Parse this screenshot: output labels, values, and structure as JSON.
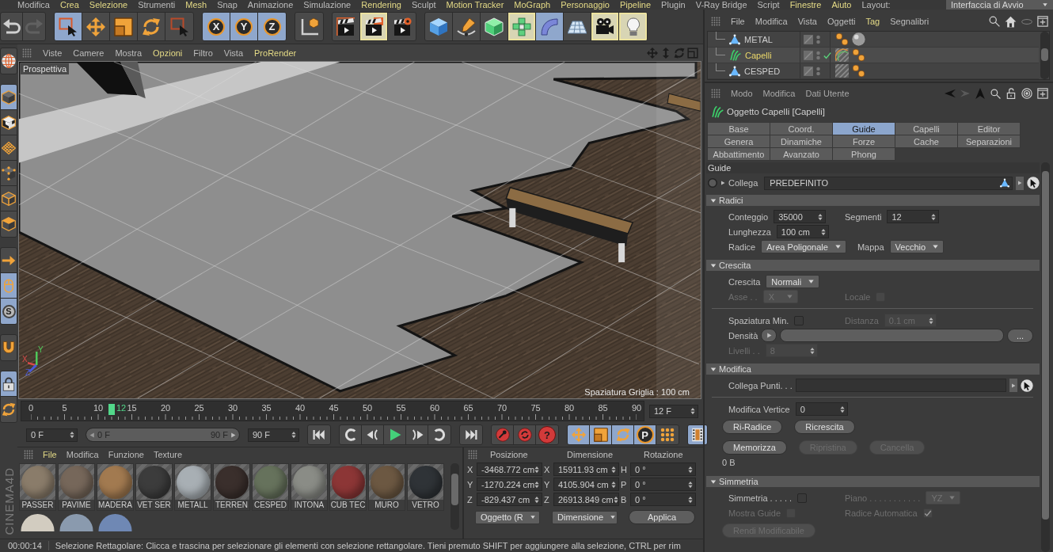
{
  "menu_bar": {
    "items": [
      {
        "label": "Modifica",
        "highlighted": false
      },
      {
        "label": "Crea",
        "highlighted": true
      },
      {
        "label": "Selezione",
        "highlighted": true
      },
      {
        "label": "Strumenti",
        "highlighted": false
      },
      {
        "label": "Mesh",
        "highlighted": true
      },
      {
        "label": "Snap",
        "highlighted": false
      },
      {
        "label": "Animazione",
        "highlighted": false
      },
      {
        "label": "Simulazione",
        "highlighted": false
      },
      {
        "label": "Rendering",
        "highlighted": true
      },
      {
        "label": "Sculpt",
        "highlighted": false
      },
      {
        "label": "Motion Tracker",
        "highlighted": true
      },
      {
        "label": "MoGraph",
        "highlighted": true
      },
      {
        "label": "Personaggio",
        "highlighted": true
      },
      {
        "label": "Pipeline",
        "highlighted": true
      },
      {
        "label": "Plugin",
        "highlighted": false
      },
      {
        "label": "V-Ray Bridge",
        "highlighted": false
      },
      {
        "label": "Script",
        "highlighted": false
      },
      {
        "label": "Finestre",
        "highlighted": true
      },
      {
        "label": "Aiuto",
        "highlighted": true
      }
    ],
    "layout_label": "Layout:",
    "layout_value": "Interfaccia di Avvio"
  },
  "toolbar": {
    "groups": [
      {
        "tools": [
          {
            "kind": "undo",
            "active": false,
            "highlighted": false,
            "disabled": false
          },
          {
            "kind": "redo",
            "active": false,
            "highlighted": false,
            "disabled": true
          }
        ]
      },
      {
        "tools": [
          {
            "kind": "liveselect",
            "active": true,
            "highlighted": false,
            "disabled": false
          },
          {
            "kind": "move",
            "active": false,
            "highlighted": false,
            "disabled": false
          },
          {
            "kind": "scale",
            "active": false,
            "highlighted": false,
            "disabled": false
          },
          {
            "kind": "rotate",
            "active": false,
            "highlighted": false,
            "disabled": false
          },
          {
            "kind": "rectselect",
            "active": false,
            "highlighted": false,
            "disabled": false
          }
        ]
      },
      {
        "tools": [
          {
            "kind": "xaxis",
            "label": "X",
            "active": true,
            "highlighted": false,
            "disabled": false
          },
          {
            "kind": "yaxis",
            "label": "Y",
            "active": true,
            "highlighted": false,
            "disabled": false
          },
          {
            "kind": "zaxis",
            "label": "Z",
            "active": true,
            "highlighted": false,
            "disabled": false
          }
        ]
      },
      {
        "tools": [
          {
            "kind": "coords",
            "active": false,
            "highlighted": false,
            "disabled": false
          }
        ]
      },
      {
        "tools": [
          {
            "kind": "renderview",
            "active": false,
            "highlighted": false,
            "disabled": false
          },
          {
            "kind": "renderpicture",
            "active": false,
            "highlighted": true,
            "disabled": false
          },
          {
            "kind": "rendersettings",
            "active": false,
            "highlighted": false,
            "disabled": false
          }
        ]
      },
      {
        "tools": [
          {
            "kind": "cube",
            "active": false,
            "highlighted": false,
            "disabled": false
          },
          {
            "kind": "pen",
            "active": false,
            "highlighted": false,
            "disabled": false
          },
          {
            "kind": "subdivision",
            "active": false,
            "highlighted": false,
            "disabled": false
          },
          {
            "kind": "cloner",
            "active": false,
            "highlighted": true,
            "disabled": false
          },
          {
            "kind": "deformer",
            "active": true,
            "highlighted": false,
            "disabled": false
          },
          {
            "kind": "floor",
            "active": false,
            "highlighted": false,
            "disabled": false
          },
          {
            "kind": "camera",
            "active": false,
            "highlighted": true,
            "disabled": false
          },
          {
            "kind": "light",
            "active": false,
            "highlighted": true,
            "disabled": false
          }
        ]
      }
    ]
  },
  "left_toolbar": {
    "groups": [
      {
        "tools": [
          {
            "kind": "globe",
            "active": false
          }
        ]
      },
      {
        "tools": [
          {
            "kind": "model",
            "active": true
          },
          {
            "kind": "texture",
            "active": false
          },
          {
            "kind": "workplane",
            "active": false
          },
          {
            "kind": "points",
            "active": false
          },
          {
            "kind": "edges",
            "active": false
          },
          {
            "kind": "polygons",
            "active": false
          }
        ]
      },
      {
        "tools": [
          {
            "kind": "arrow",
            "active": false
          },
          {
            "kind": "mouse",
            "active": true
          },
          {
            "kind": "snap",
            "label": "S",
            "active": true
          }
        ]
      },
      {
        "tools": [
          {
            "kind": "magnet",
            "active": false
          }
        ]
      },
      {
        "tools": [
          {
            "kind": "lockgrid",
            "active": true
          },
          {
            "kind": "rotategrid",
            "active": false
          }
        ]
      }
    ],
    "logo": "CINEMA4D"
  },
  "viewport": {
    "menu": [
      {
        "label": "Viste",
        "highlighted": false
      },
      {
        "label": "Camere",
        "highlighted": false
      },
      {
        "label": "Mostra",
        "highlighted": false
      },
      {
        "label": "Opzioni",
        "highlighted": true
      },
      {
        "label": "Filtro",
        "highlighted": false
      },
      {
        "label": "Vista",
        "highlighted": false
      },
      {
        "label": "ProRender",
        "highlighted": true
      }
    ],
    "camera": "Prospettiva",
    "axes": [
      {
        "label": "X",
        "color": "#d84a4a"
      },
      {
        "label": "Y",
        "color": "#4ec85a"
      },
      {
        "label": "Z",
        "color": "#4a5ad8"
      }
    ],
    "grid_spacing": "Spaziatura Griglia : 100 cm"
  },
  "timeline": {
    "ticks": [
      "0",
      "5",
      "10",
      "15",
      "20",
      "25",
      "30",
      "35",
      "40",
      "45",
      "50",
      "55",
      "60",
      "65",
      "70",
      "75",
      "80",
      "85",
      "90"
    ],
    "level": 0.1333,
    "current": "12",
    "current_field": "12 F",
    "start_field": "0 F",
    "range": {
      "start": "0 F",
      "end": "90 F",
      "level": 1
    },
    "end_field": "90 F",
    "transport": [
      {
        "tools": [
          {
            "kind": "tostart",
            "active": false
          }
        ]
      },
      {
        "tools": [
          {
            "kind": "prevkey",
            "active": false
          },
          {
            "kind": "prevframe",
            "active": false
          },
          {
            "kind": "play",
            "active": false
          },
          {
            "kind": "nextframe",
            "active": false
          },
          {
            "kind": "nextkey",
            "active": false
          }
        ]
      },
      {
        "tools": [
          {
            "kind": "toend",
            "active": false
          }
        ]
      },
      {
        "tools": [
          {
            "kind": "record",
            "active": false
          },
          {
            "kind": "autokey",
            "active": false
          },
          {
            "kind": "keyselection",
            "label": "?",
            "active": false
          }
        ]
      },
      {
        "tools": [
          {
            "kind": "keymove",
            "active": true
          },
          {
            "kind": "keyscale",
            "active": true
          },
          {
            "kind": "keyrotate",
            "active": true
          },
          {
            "kind": "keyparam",
            "label": "P",
            "active": true
          },
          {
            "kind": "keypoints",
            "active": false
          }
        ]
      },
      {
        "tools": [
          {
            "kind": "film",
            "active": true
          }
        ]
      }
    ]
  },
  "materials": {
    "menu": [
      {
        "label": "File",
        "highlighted": true
      },
      {
        "label": "Modifica",
        "highlighted": false
      },
      {
        "label": "Funzione",
        "highlighted": false
      },
      {
        "label": "Texture",
        "highlighted": false
      }
    ],
    "items": [
      {
        "name": "PASSER",
        "color": "#8a7c6a"
      },
      {
        "name": "PAVIME",
        "color": "#76675a"
      },
      {
        "name": "MADERA",
        "color": "#a27a50"
      },
      {
        "name": "VET SER",
        "color": "#3c3c3c"
      },
      {
        "name": "METALL",
        "color": "#a8afb4"
      },
      {
        "name": "TERREN",
        "color": "#3a2f2c"
      },
      {
        "name": "CESPED",
        "color": "#66725c"
      },
      {
        "name": "INTONA",
        "color": "#8a8c86"
      },
      {
        "name": "CUB TEC",
        "color": "#8c3636"
      },
      {
        "name": "MURO",
        "color": "#6c5842"
      },
      {
        "name": "VETRO",
        "color": "#2f3337"
      },
      {
        "color": "#d2ccc0"
      },
      {
        "color": "#8a9aae"
      },
      {
        "color": "#6f88b4"
      }
    ]
  },
  "coordinates": {
    "headers": [
      "Posizione",
      "Dimensione",
      "Rotazione"
    ],
    "rows": [
      {
        "cells": [
          {
            "axis": "X",
            "value": "-3468.772 cm"
          },
          {
            "axis": "X",
            "value": "15911.93 cm"
          },
          {
            "axis": "H",
            "value": "0 °"
          }
        ]
      },
      {
        "cells": [
          {
            "axis": "Y",
            "value": "-1270.224 cm"
          },
          {
            "axis": "Y",
            "value": "4105.904 cm"
          },
          {
            "axis": "P",
            "value": "0 °"
          }
        ]
      },
      {
        "cells": [
          {
            "axis": "Z",
            "value": "-829.437 cm"
          },
          {
            "axis": "Z",
            "value": "26913.849 cm"
          },
          {
            "axis": "B",
            "value": "0 °"
          }
        ]
      }
    ],
    "mode_dropdown": "Oggetto (R",
    "size_dropdown": "Dimensione",
    "apply_button": "Applica"
  },
  "status_bar": {
    "time": "00:00:14",
    "message": "Selezione Rettagolare: Clicca e trascina per selezionare gli elementi con selezione rettangolare. Tieni premuto SHIFT per aggiungere alla selezione, CTRL per rim"
  },
  "object_manager": {
    "menu": [
      {
        "label": "File",
        "highlighted": false
      },
      {
        "label": "Modifica",
        "highlighted": false
      },
      {
        "label": "Vista",
        "highlighted": false
      },
      {
        "label": "Oggetti",
        "highlighted": false
      },
      {
        "label": "Tag",
        "highlighted": true
      },
      {
        "label": "Segnalibri",
        "highlighted": false
      }
    ],
    "objects": [
      {
        "name": "METAL",
        "kind": "polygon",
        "selected": false,
        "checked": false,
        "tags": [
          {
            "kind": "phong"
          },
          {
            "kind": "material"
          }
        ]
      },
      {
        "name": "Capelli",
        "kind": "hair",
        "selected": true,
        "checked": true,
        "tags": [
          {
            "kind": "hairmaterial"
          },
          {
            "kind": "phong"
          }
        ]
      },
      {
        "name": "CESPED",
        "kind": "polygon",
        "selected": false,
        "checked": false,
        "tags": [
          {
            "kind": "striped"
          },
          {
            "kind": "phong"
          }
        ]
      }
    ]
  },
  "attributes": {
    "menu": [
      {
        "label": "Modo"
      },
      {
        "label": "Modifica"
      },
      {
        "label": "Dati Utente"
      }
    ],
    "title": "Oggetto Capelli [Capelli]",
    "tabs": [
      {
        "label": "Base",
        "selected": false
      },
      {
        "label": "Coord.",
        "selected": false
      },
      {
        "label": "Guide",
        "selected": true
      },
      {
        "label": "Capelli",
        "selected": false
      },
      {
        "label": "Editor",
        "selected": false
      },
      {
        "label": "Genera",
        "selected": false
      },
      {
        "label": "Dinamiche",
        "selected": false
      },
      {
        "label": "Forze",
        "selected": false
      },
      {
        "label": "Cache",
        "selected": false
      },
      {
        "label": "Separazioni",
        "selected": false
      },
      {
        "label": "Abbattimento",
        "selected": false
      },
      {
        "label": "Avanzato",
        "selected": false
      },
      {
        "label": "Phong",
        "selected": false
      }
    ],
    "group": "Guide",
    "link": {
      "label": "Collega",
      "value": "PREDEFINITO"
    },
    "sections": [
      {
        "title": "Radici",
        "expanded": true,
        "rows": [
          {
            "kind": "controls",
            "items": [
              {
                "kind": "spin",
                "label": "Conteggio",
                "value": "35000",
                "disabled": false
              },
              {
                "kind": "spin",
                "label": "Segmenti",
                "value": "12",
                "disabled": false
              }
            ]
          },
          {
            "kind": "controls",
            "items": [
              {
                "kind": "spin",
                "label": "Lunghezza",
                "value": "100 cm",
                "disabled": false
              }
            ]
          },
          {
            "kind": "controls",
            "items": [
              {
                "kind": "dropdown",
                "label": "Radice",
                "value": "Area Poligonale",
                "disabled": false
              },
              {
                "kind": "dropdown",
                "label": "Mappa",
                "value": "Vecchio",
                "disabled": false
              }
            ]
          }
        ]
      },
      {
        "title": "Crescita",
        "expanded": true,
        "rows": [
          {
            "kind": "controls",
            "items": [
              {
                "kind": "dropdown",
                "label": "Crescita",
                "value": "Normali",
                "disabled": false
              }
            ]
          },
          {
            "kind": "controls",
            "items": [
              {
                "kind": "dropdown",
                "label": "Asse . .",
                "value": "X",
                "disabled": true
              },
              {
                "kind": "checkbox",
                "label": "Locale",
                "checked": false,
                "disabled": true
              }
            ]
          },
          {
            "kind": "separator"
          },
          {
            "kind": "controls",
            "items": [
              {
                "kind": "checkbox",
                "label": "Spaziatura Min.",
                "checked": false,
                "disabled": false
              },
              {
                "kind": "spin",
                "label": "Distanza",
                "value": "0.1 cm",
                "disabled": true
              }
            ]
          },
          {
            "kind": "controls",
            "items": [
              {
                "kind": "shader",
                "label": "Densità",
                "button": "...",
                "disabled": false
              }
            ]
          },
          {
            "kind": "controls",
            "items": [
              {
                "kind": "spin",
                "label": "Livelli . .",
                "value": "8",
                "disabled": true
              }
            ]
          }
        ]
      },
      {
        "title": "Modifica",
        "expanded": true,
        "rows": [
          {
            "kind": "controls",
            "items": [
              {
                "kind": "link",
                "label": "Collega Punti. . .",
                "disabled": false
              }
            ]
          },
          {
            "kind": "separator"
          },
          {
            "kind": "controls",
            "items": [
              {
                "kind": "spin",
                "label": "Modifica Vertice",
                "value": "0",
                "disabled": false
              }
            ]
          },
          {
            "kind": "buttons",
            "items": [
              {
                "kind": "button",
                "label": "Ri-Radice",
                "disabled": false
              },
              {
                "kind": "button",
                "label": "Ricrescita",
                "disabled": false
              }
            ]
          },
          {
            "kind": "buttons",
            "items": [
              {
                "kind": "button",
                "label": "Memorizza",
                "disabled": false
              },
              {
                "kind": "button",
                "label": "Ripristina",
                "disabled": true
              },
              {
                "kind": "button",
                "label": "Cancella",
                "disabled": true
              }
            ]
          },
          {
            "kind": "note",
            "text": "0 B"
          }
        ]
      },
      {
        "title": "Simmetria",
        "expanded": true,
        "rows": [
          {
            "kind": "controls",
            "items": [
              {
                "kind": "checkbox",
                "label": "Simmetria . . . . .",
                "checked": false,
                "disabled": false
              },
              {
                "kind": "dropdown",
                "label": "Piano . . . . . . . . . . .",
                "value": "YZ",
                "disabled": true
              }
            ]
          },
          {
            "kind": "controls",
            "items": [
              {
                "kind": "checkbox",
                "label": "Mostra Guide",
                "checked": false,
                "disabled": true
              },
              {
                "kind": "checkbox",
                "label": "Radice Automatica",
                "checked": true,
                "disabled": true
              }
            ]
          },
          {
            "kind": "buttons",
            "items": [
              {
                "kind": "button",
                "label": "Rendi Modificabile",
                "disabled": true
              }
            ]
          }
        ]
      }
    ]
  }
}
